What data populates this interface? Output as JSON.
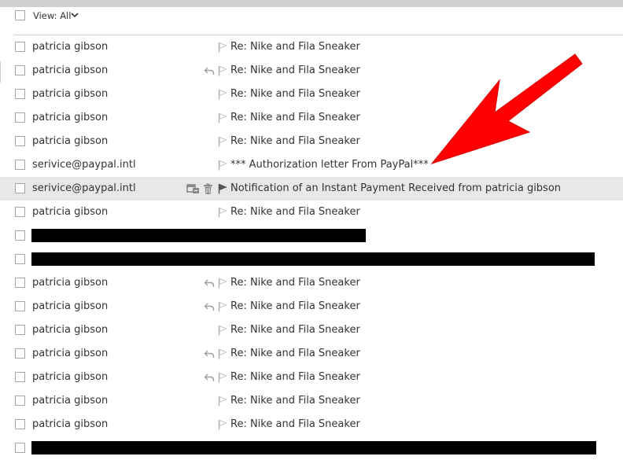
{
  "view": {
    "label": "View: All"
  },
  "messages": [
    {
      "sender": "patricia gibson",
      "subject": "Re: Nike and Fila Sneaker",
      "replied": false,
      "highlighted": false
    },
    {
      "sender": "patricia gibson",
      "subject": "Re: Nike and Fila Sneaker",
      "replied": true,
      "highlighted": false
    },
    {
      "sender": "patricia gibson",
      "subject": "Re: Nike and Fila Sneaker",
      "replied": false,
      "highlighted": false
    },
    {
      "sender": "patricia gibson",
      "subject": "Re: Nike and Fila Sneaker",
      "replied": false,
      "highlighted": false
    },
    {
      "sender": "patricia gibson",
      "subject": "Re: Nike and Fila Sneaker",
      "replied": false,
      "highlighted": false
    },
    {
      "sender": "serivice@paypal.intl",
      "subject": "*** Authorization letter From PayPal***",
      "replied": false,
      "highlighted": false
    },
    {
      "sender": "serivice@paypal.intl",
      "subject": "Notification of an Instant Payment Received from patricia gibson",
      "replied": false,
      "highlighted": true
    },
    {
      "sender": "patricia gibson",
      "subject": "Re: Nike and Fila Sneaker",
      "replied": false,
      "highlighted": false
    },
    {
      "redacted": true
    },
    {
      "redacted": true
    },
    {
      "sender": "patricia gibson",
      "subject": "Re: Nike and Fila Sneaker",
      "replied": true,
      "highlighted": false
    },
    {
      "sender": "patricia gibson",
      "subject": "Re: Nike and Fila Sneaker",
      "replied": true,
      "highlighted": false
    },
    {
      "sender": "patricia gibson",
      "subject": "Re: Nike and Fila Sneaker",
      "replied": false,
      "highlighted": false
    },
    {
      "sender": "patricia gibson",
      "subject": "Re: Nike and Fila Sneaker",
      "replied": true,
      "highlighted": false
    },
    {
      "sender": "patricia gibson",
      "subject": "Re: Nike and Fila Sneaker",
      "replied": true,
      "highlighted": false
    },
    {
      "sender": "patricia gibson",
      "subject": "Re: Nike and Fila Sneaker",
      "replied": false,
      "highlighted": false
    },
    {
      "sender": "patricia gibson",
      "subject": "Re: Nike and Fila Sneaker",
      "replied": false,
      "highlighted": false
    },
    {
      "redacted": true
    }
  ],
  "icons": {
    "checkbox": "checkbox-icon",
    "reply": "reply-icon",
    "flag": "flag-icon",
    "calendar_move": "calendar-move-icon",
    "trash": "trash-icon",
    "view_chevron": "chevron-down-icon",
    "annotation": "red-arrow-annotation"
  },
  "colors": {
    "highlight_row": "#e8e8e8",
    "annotation_arrow": "#ff0000",
    "redaction": "#000000"
  }
}
